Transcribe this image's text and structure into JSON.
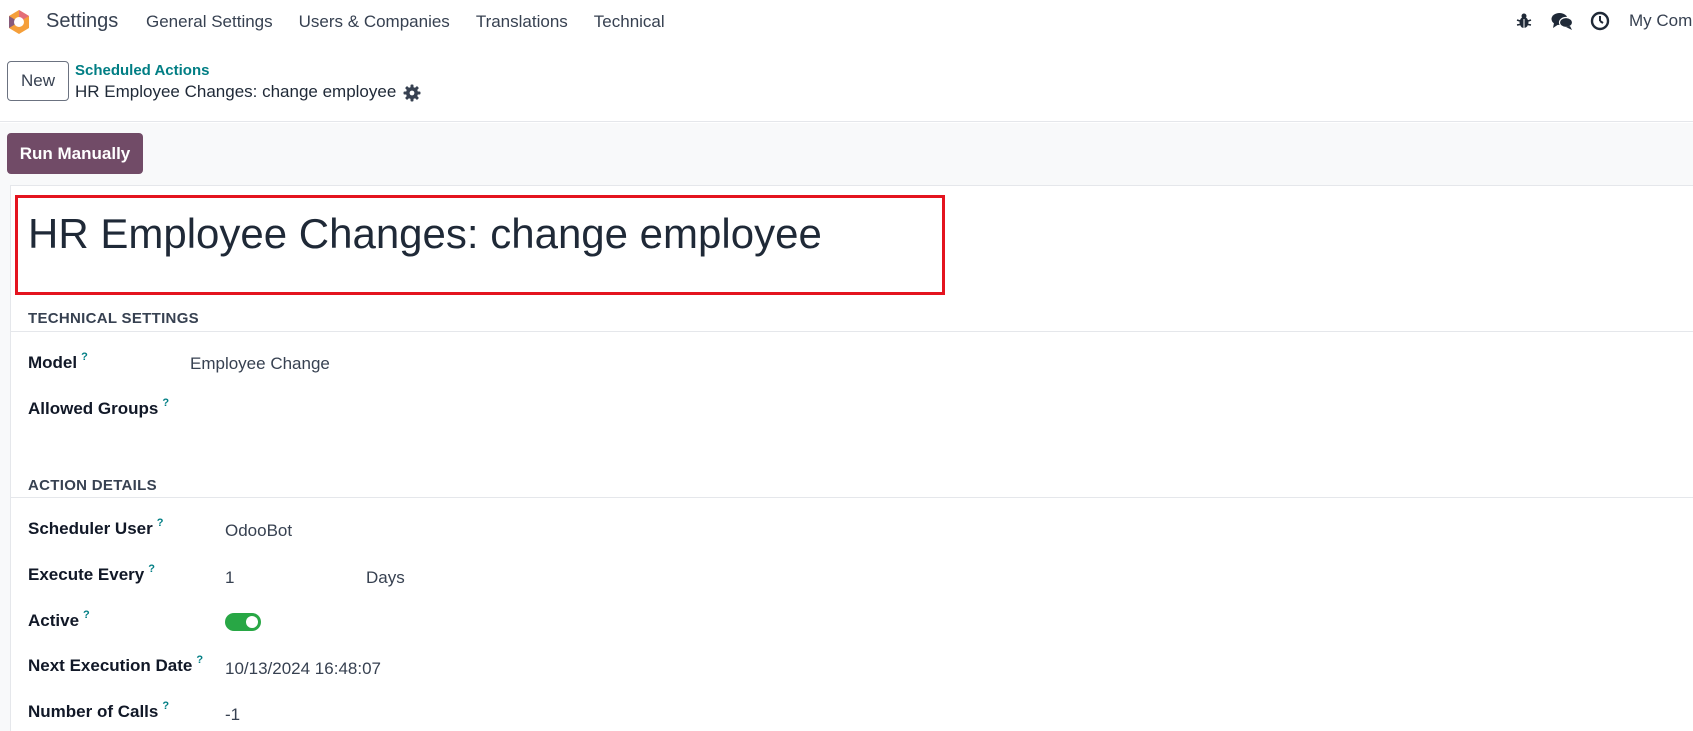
{
  "app": {
    "name": "Settings"
  },
  "nav": {
    "items": [
      "General Settings",
      "Users & Companies",
      "Translations",
      "Technical"
    ],
    "company": "My Com",
    "icons": [
      "bug-icon",
      "chat-icon",
      "clock-icon"
    ]
  },
  "control": {
    "new_label": "New",
    "breadcrumb_parent": "Scheduled Actions",
    "breadcrumb_current": "HR Employee Changes: change employee"
  },
  "actions": {
    "run_label": "Run Manually"
  },
  "record": {
    "title": "HR Employee Changes: change employee"
  },
  "sections": {
    "technical": {
      "title": "TECHNICAL SETTINGS",
      "model_label": "Model",
      "model_value": "Employee Change",
      "groups_label": "Allowed Groups"
    },
    "action": {
      "title": "ACTION DETAILS",
      "user_label": "Scheduler User",
      "user_value": "OdooBot",
      "every_label": "Execute Every",
      "every_value": "1",
      "every_unit": "Days",
      "active_label": "Active",
      "active_value": true,
      "next_label": "Next Execution Date",
      "next_value": "10/13/2024 16:48:07",
      "calls_label": "Number of Calls",
      "calls_value": "-1"
    }
  },
  "help_mark": "?",
  "colors": {
    "brand": "#714b67",
    "link": "#017e84",
    "highlight": "#e4141f",
    "toggle_on": "#28a745"
  }
}
